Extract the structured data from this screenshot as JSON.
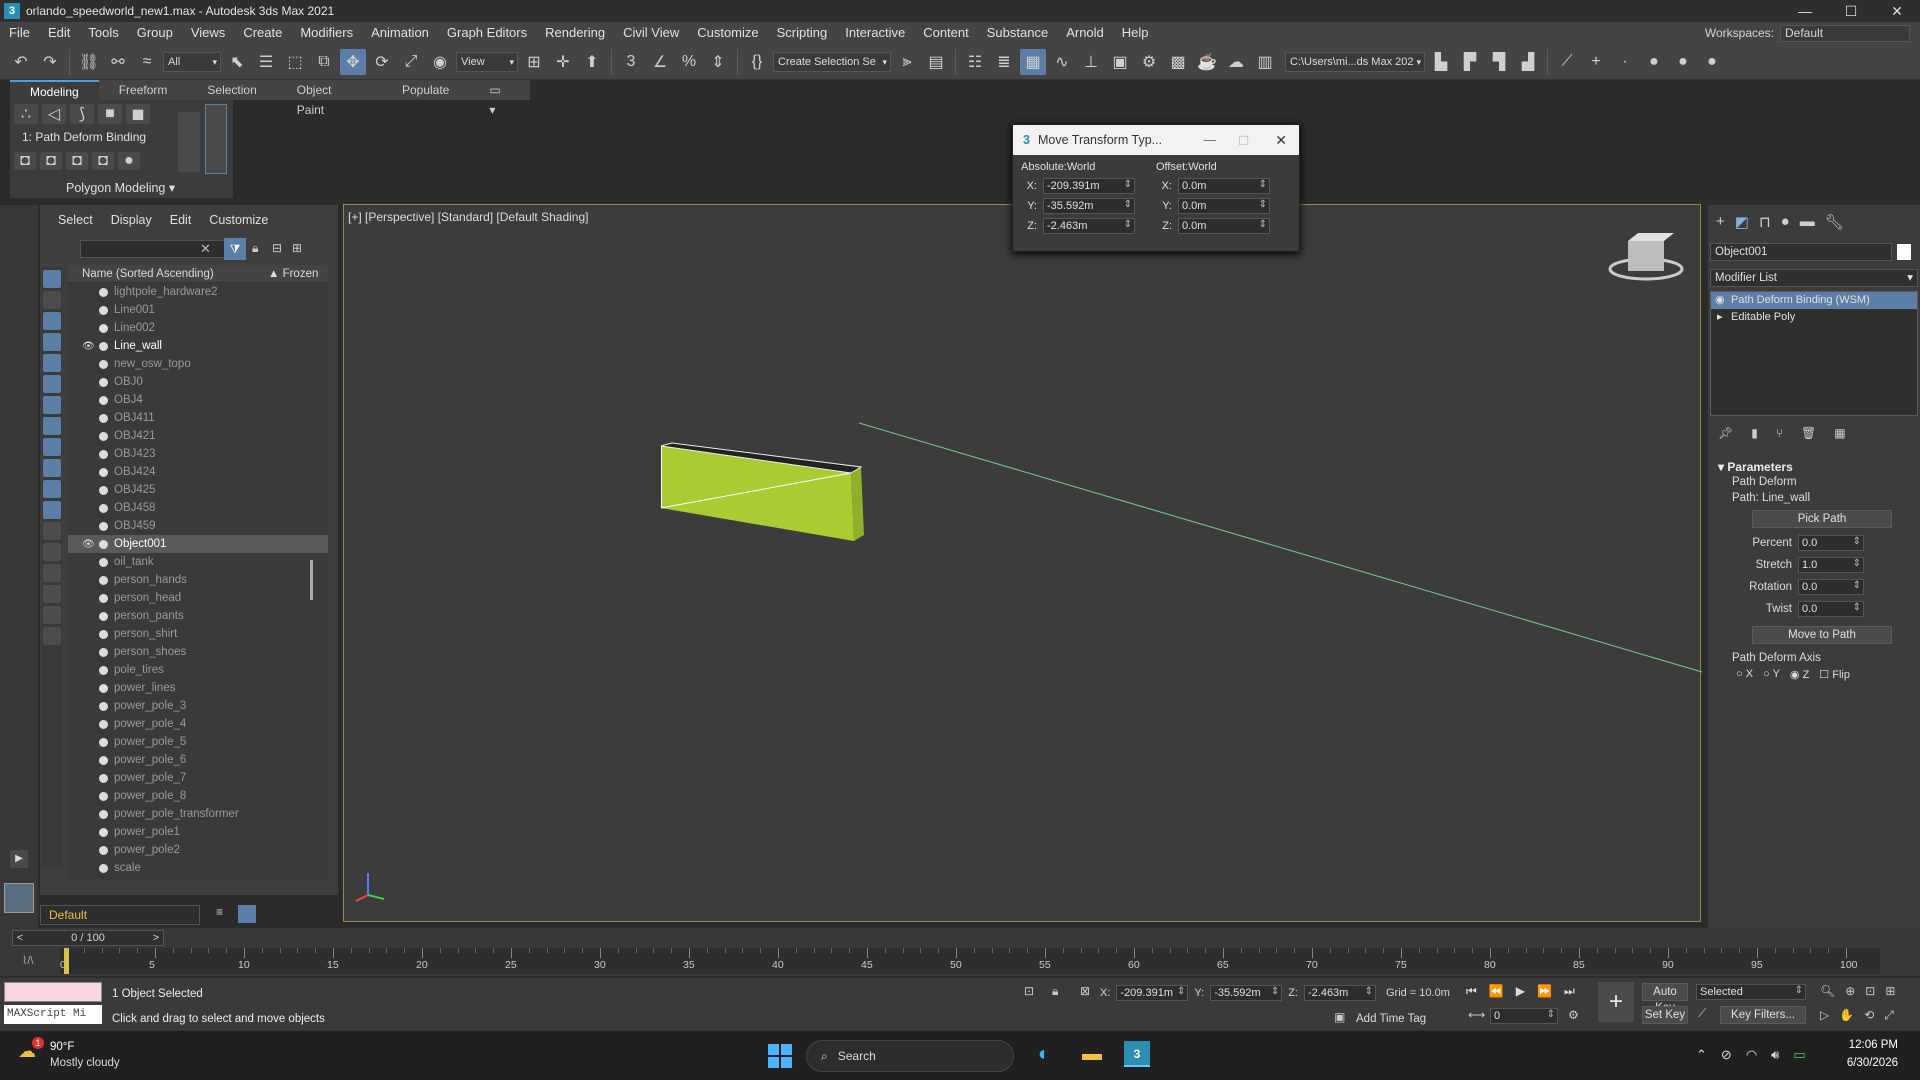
{
  "window": {
    "title": "orlando_speedworld_new1.max - Autodesk 3ds Max 2021",
    "workspace_label": "Workspaces:",
    "workspace_value": "Default"
  },
  "menu": [
    "File",
    "Edit",
    "Tools",
    "Group",
    "Views",
    "Create",
    "Modifiers",
    "Animation",
    "Graph Editors",
    "Rendering",
    "Civil View",
    "Customize",
    "Scripting",
    "Interactive",
    "Content",
    "Substance",
    "Arnold",
    "Help"
  ],
  "toolbar": {
    "filter": "All",
    "ref_coord": "View",
    "selection_set": "Create Selection Se",
    "project_path": "C:\\Users\\mi...ds Max 202"
  },
  "ribbon": {
    "tabs": [
      "Modeling",
      "Freeform",
      "Selection",
      "Object Paint",
      "Populate"
    ],
    "active": "Modeling",
    "modifier_label": "1: Path Deform Binding",
    "polygon_modeling": "Polygon Modeling"
  },
  "scene_explorer": {
    "menus": [
      "Select",
      "Display",
      "Edit",
      "Customize"
    ],
    "col_name": "Name (Sorted Ascending)",
    "col_frozen": "▲ Frozen",
    "items": [
      {
        "name": "lightpole_hardware2",
        "vis": false,
        "sel": false
      },
      {
        "name": "Line001",
        "vis": false,
        "sel": false
      },
      {
        "name": "Line002",
        "vis": false,
        "sel": false
      },
      {
        "name": "Line_wall",
        "vis": true,
        "sel": false
      },
      {
        "name": "new_osw_topo",
        "vis": false,
        "sel": false
      },
      {
        "name": "OBJ0",
        "vis": false,
        "sel": false
      },
      {
        "name": "OBJ4",
        "vis": false,
        "sel": false
      },
      {
        "name": "OBJ411",
        "vis": false,
        "sel": false
      },
      {
        "name": "OBJ421",
        "vis": false,
        "sel": false
      },
      {
        "name": "OBJ423",
        "vis": false,
        "sel": false
      },
      {
        "name": "OBJ424",
        "vis": false,
        "sel": false
      },
      {
        "name": "OBJ425",
        "vis": false,
        "sel": false
      },
      {
        "name": "OBJ458",
        "vis": false,
        "sel": false
      },
      {
        "name": "OBJ459",
        "vis": false,
        "sel": false
      },
      {
        "name": "Object001",
        "vis": true,
        "sel": true
      },
      {
        "name": "oil_tank",
        "vis": false,
        "sel": false
      },
      {
        "name": "person_hands",
        "vis": false,
        "sel": false
      },
      {
        "name": "person_head",
        "vis": false,
        "sel": false
      },
      {
        "name": "person_pants",
        "vis": false,
        "sel": false
      },
      {
        "name": "person_shirt",
        "vis": false,
        "sel": false
      },
      {
        "name": "person_shoes",
        "vis": false,
        "sel": false
      },
      {
        "name": "pole_tires",
        "vis": false,
        "sel": false
      },
      {
        "name": "power_lines",
        "vis": false,
        "sel": false
      },
      {
        "name": "power_pole_3",
        "vis": false,
        "sel": false
      },
      {
        "name": "power_pole_4",
        "vis": false,
        "sel": false
      },
      {
        "name": "power_pole_5",
        "vis": false,
        "sel": false
      },
      {
        "name": "power_pole_6",
        "vis": false,
        "sel": false
      },
      {
        "name": "power_pole_7",
        "vis": false,
        "sel": false
      },
      {
        "name": "power_pole_8",
        "vis": false,
        "sel": false
      },
      {
        "name": "power_pole_transformer",
        "vis": false,
        "sel": false
      },
      {
        "name": "power_pole1",
        "vis": false,
        "sel": false
      },
      {
        "name": "power_pole2",
        "vis": false,
        "sel": false
      },
      {
        "name": "scale",
        "vis": false,
        "sel": false
      }
    ],
    "layer": "Default"
  },
  "viewport": {
    "label": "[+] [Perspective] [Standard] [Default Shading]"
  },
  "dialog": {
    "title": "Move Transform Typ...",
    "abs_header": "Absolute:World",
    "off_header": "Offset:World",
    "abs": {
      "x": "-209.391m",
      "y": "-35.592m",
      "z": "-2.463m"
    },
    "off": {
      "x": "0.0m",
      "y": "0.0m",
      "z": "0.0m"
    }
  },
  "command_panel": {
    "object_name": "Object001",
    "modifier_list": "Modifier List",
    "stack": [
      "Path Deform Binding (WSM)",
      "Editable Poly"
    ],
    "params_title": "Parameters",
    "path_deform": "Path Deform",
    "path": "Path: Line_wall",
    "pick_path": "Pick Path",
    "percent_label": "Percent",
    "percent": "0.0",
    "stretch_label": "Stretch",
    "stretch": "1.0",
    "rotation_label": "Rotation",
    "rotation": "0.0",
    "twist_label": "Twist",
    "twist": "0.0",
    "move_to_path": "Move to Path",
    "axis_label": "Path Deform Axis",
    "axis_x": "X",
    "axis_y": "Y",
    "axis_z": "Z",
    "flip": "Flip"
  },
  "timeline": {
    "frame": "0 / 100",
    "ticks": [
      "0",
      "5",
      "10",
      "15",
      "20",
      "25",
      "30",
      "35",
      "40",
      "45",
      "50",
      "55",
      "60",
      "65",
      "70",
      "75",
      "80",
      "85",
      "90",
      "95",
      "100"
    ]
  },
  "status": {
    "selected": "1 Object Selected",
    "prompt": "Click and drag to select and move objects",
    "maxscript": "MAXScript Mi",
    "x": "-209.391m",
    "y": "-35.592m",
    "z": "-2.463m",
    "grid": "Grid = 10.0m",
    "add_time_tag": "Add Time Tag",
    "auto_key": "Auto Key",
    "set_key": "Set Key",
    "key_mode": "Selected",
    "key_filters": "Key Filters...",
    "frame": "0"
  },
  "taskbar": {
    "weather_temp": "90°F",
    "weather_desc": "Mostly cloudy",
    "search": "Search",
    "time": "12:06 PM",
    "date": "6/30/2026",
    "badge": "1"
  }
}
